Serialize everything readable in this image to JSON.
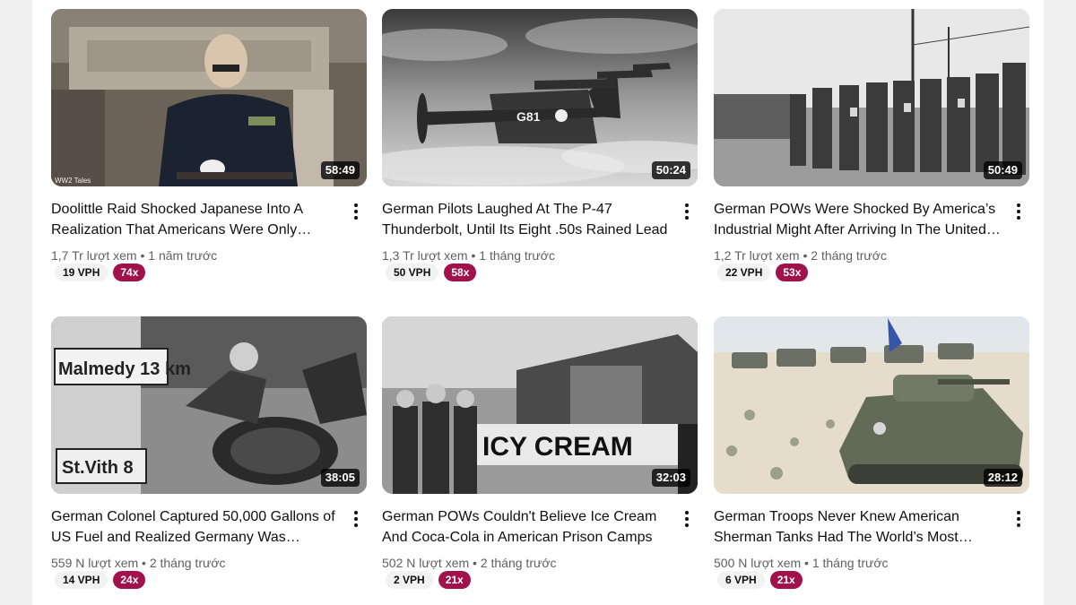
{
  "videos": [
    {
      "title": "Doolittle Raid Shocked Japanese Into A Realization That Americans Were Only Getting Started",
      "duration": "58:49",
      "views": "1,7 Tr lượt xem",
      "age": "1 năm trước",
      "vph": "19 VPH",
      "multiplier": "74x",
      "watermark": "WW2 Tales"
    },
    {
      "title": "German Pilots Laughed At The P-47 Thunderbolt, Until Its Eight .50s Rained Lead",
      "duration": "50:24",
      "views": "1,3 Tr lượt xem",
      "age": "1 tháng trước",
      "vph": "50 VPH",
      "multiplier": "58x"
    },
    {
      "title": "German POWs Were Shocked By America’s Industrial Might After Arriving In The United States",
      "duration": "50:49",
      "views": "1,2 Tr lượt xem",
      "age": "2 tháng trước",
      "vph": "22 VPH",
      "multiplier": "53x"
    },
    {
      "title": "German Colonel Captured 50,000 Gallons of US Fuel and Realized Germany Was Doomed",
      "duration": "38:05",
      "views": "559 N lượt xem",
      "age": "2 tháng trước",
      "vph": "14 VPH",
      "multiplier": "24x"
    },
    {
      "title": "German POWs Couldn't Believe Ice Cream And Coca-Cola in American Prison Camps",
      "duration": "32:03",
      "views": "502 N lượt xem",
      "age": "2 tháng trước",
      "vph": "2 VPH",
      "multiplier": "21x"
    },
    {
      "title": "German Troops Never Knew American Sherman Tanks Had The World’s Most Advanced Technology",
      "duration": "28:12",
      "views": "500 N lượt xem",
      "age": "1 tháng trước",
      "vph": "6 VPH",
      "multiplier": "21x"
    }
  ],
  "meta_separator": " • ",
  "thumbnail_art": {
    "sign_malmedy": "Malmedy 13 km",
    "sign_stvith": "St.Vith 8",
    "banner_icecream": "ICY CREAM",
    "plane_code": "G81"
  },
  "colors": {
    "multiplier_badge": "#a1124a",
    "vph_badge": "#f2f2f2"
  }
}
